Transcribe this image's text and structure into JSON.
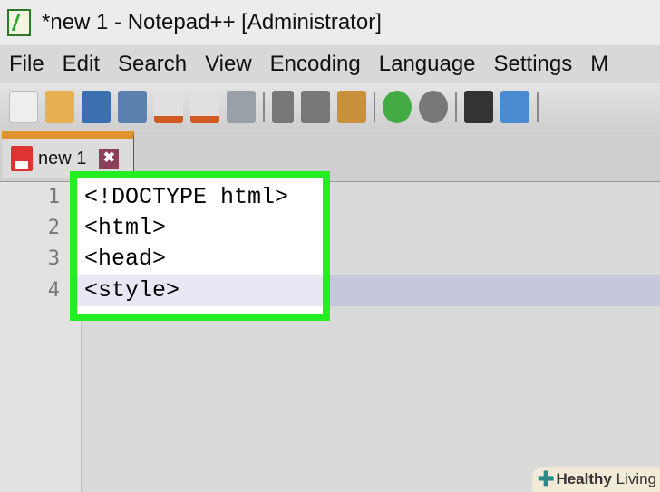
{
  "window": {
    "title": "*new 1 - Notepad++ [Administrator]"
  },
  "menu": [
    "File",
    "Edit",
    "Search",
    "View",
    "Encoding",
    "Language",
    "Settings",
    "M"
  ],
  "toolbar": [
    "new",
    "open",
    "save",
    "save-all",
    "close",
    "close-all",
    "print",
    "cut",
    "copy",
    "paste",
    "undo",
    "redo",
    "find",
    "replace"
  ],
  "tab": {
    "label": "new 1",
    "close": "✖"
  },
  "editor": {
    "lines": [
      {
        "num": "1",
        "text": "<!DOCTYPE html>"
      },
      {
        "num": "2",
        "text": "<html>"
      },
      {
        "num": "3",
        "text": "<head>"
      },
      {
        "num": "4",
        "text": "<style>"
      }
    ]
  },
  "watermark": {
    "brand": "Healthy",
    "rest": " Living"
  },
  "colors": {
    "highlight_box": "#22ee22",
    "tab_accent": "#e0932c",
    "current_line": "#c6c6dc"
  }
}
